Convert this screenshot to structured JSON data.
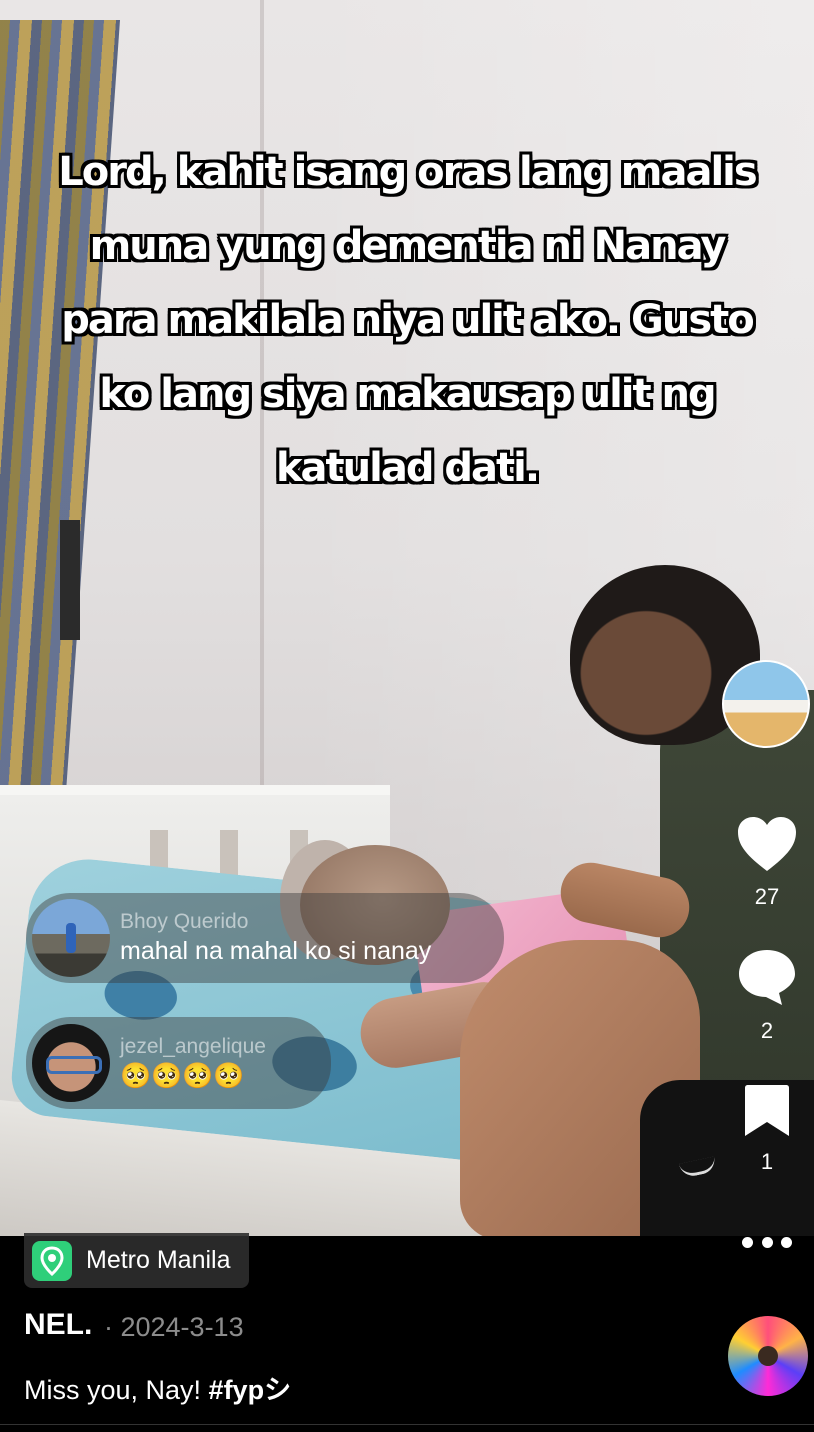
{
  "video": {
    "caption": "Lord, kahit isang oras lang maalis muna yung dementia ni Nanay para makilala niya ulit ako. Gusto ko lang siya makausap ulit ng katulad dati."
  },
  "comments": [
    {
      "user": "Bhoy Querido",
      "text": "mahal na mahal ko si nanay"
    },
    {
      "user": "jezel_angelique",
      "text": "🥺🥺🥺🥺"
    }
  ],
  "rail": {
    "likes": "27",
    "comments": "2",
    "saves": "1"
  },
  "location": "Metro Manila",
  "post": {
    "author": "NEL.",
    "date": "· 2024-3-13",
    "caption": "Miss you, Nay! ",
    "hashtag": "#fypシ"
  },
  "icons": {
    "like": "heart-icon",
    "comment": "comment-bubble-icon",
    "save": "bookmark-icon",
    "more": "more-dots-icon",
    "location": "location-pin-icon"
  }
}
